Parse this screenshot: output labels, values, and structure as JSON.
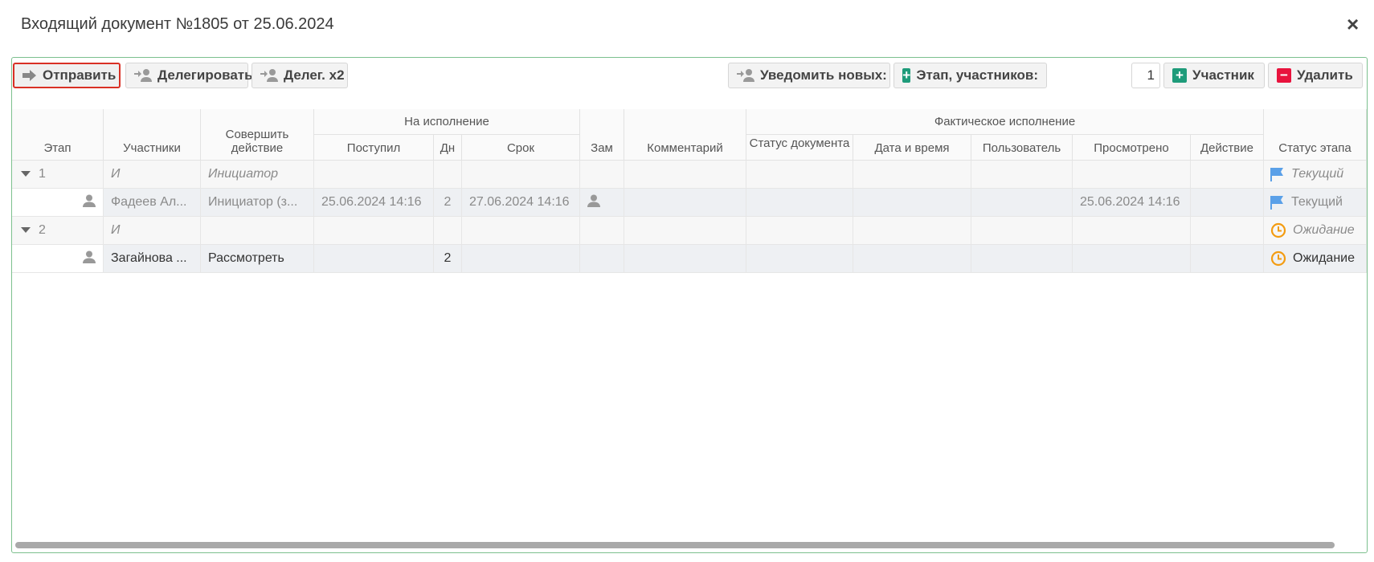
{
  "dialog": {
    "title": "Входящий документ №1805 от 25.06.2024",
    "close": "×"
  },
  "toolbar": {
    "send": "Отправить",
    "delegate": "Делегировать",
    "delegate_x2": "Делег. x2",
    "notify_new": "Уведомить новых:",
    "stage_participants": "Этап, участников:",
    "participants_count": "1",
    "participant": "Участник",
    "delete": "Удалить"
  },
  "columns": {
    "stage": "Этап",
    "participants": "Участники",
    "action": "Совершить действие",
    "group_execution": "На исполнение",
    "received": "Поступил",
    "days": "Дн",
    "deadline": "Срок",
    "deputy": "Зам",
    "comment": "Комментарий",
    "group_actual": "Фактическое исполнение",
    "doc_status": "Статус документа",
    "date_time": "Дата и время",
    "user": "Пользователь",
    "viewed": "Просмотрено",
    "act": "Действие",
    "stage_status": "Статус этапа"
  },
  "rows": [
    {
      "type": "group",
      "stage": "1",
      "participants": "И",
      "action": "Инициатор",
      "status": "Текущий",
      "status_icon": "flag-icon"
    },
    {
      "type": "item",
      "participants": "Фадеев Ал...",
      "action": "Инициатор (з...",
      "received": "25.06.2024 14:16",
      "days": "2",
      "deadline": "27.06.2024 14:16",
      "viewed": "25.06.2024 14:16",
      "status": "Текущий",
      "status_icon": "flag-icon"
    },
    {
      "type": "group",
      "stage": "2",
      "participants": "И",
      "action": "",
      "status": "Ожидание",
      "status_icon": "clock-icon"
    },
    {
      "type": "item",
      "participants": "Загайнова ...",
      "action": "Рассмотреть",
      "received": "",
      "days": "2",
      "deadline": "",
      "viewed": "",
      "status": "Ожидание",
      "status_icon": "clock-icon"
    }
  ],
  "colors": {
    "accent_green": "#1e9b7a",
    "danger_red": "#e8133d",
    "flag_blue": "#5aa0e8",
    "clock_orange": "#f39c12",
    "panel_border": "#7cc08e"
  }
}
